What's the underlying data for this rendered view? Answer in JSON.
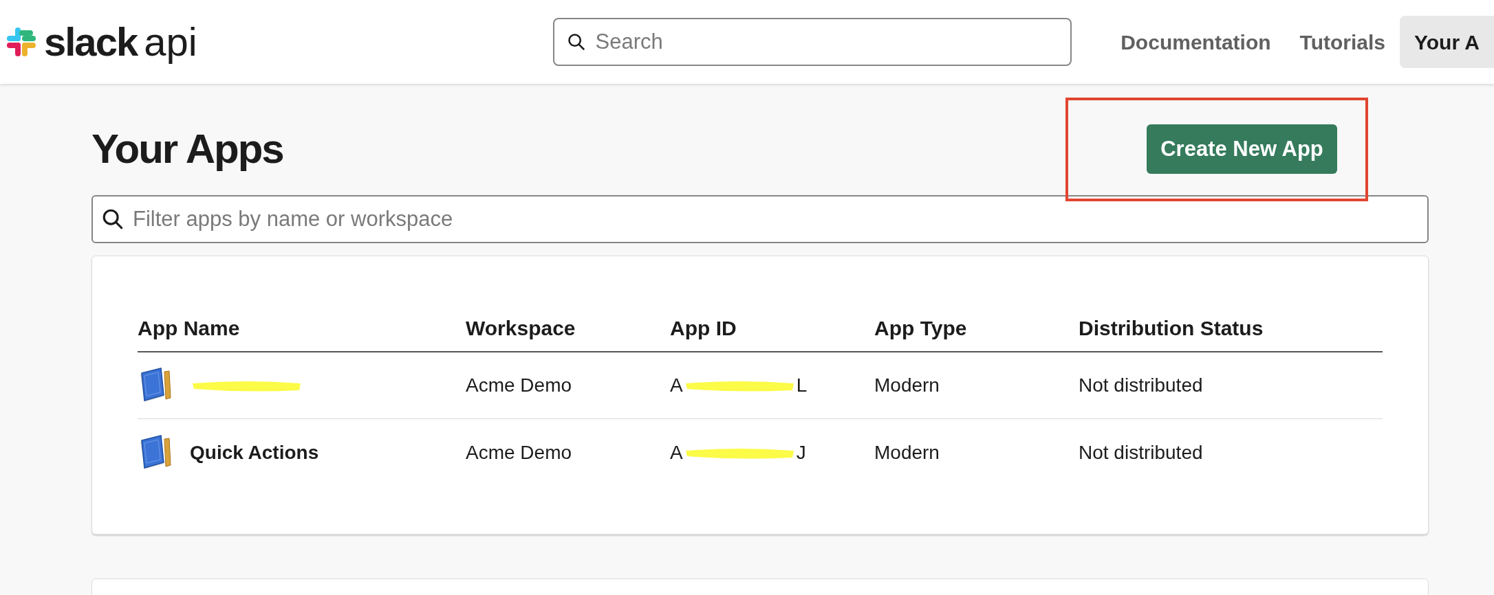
{
  "header": {
    "logo": {
      "brand": "slack",
      "product": "api"
    },
    "search": {
      "placeholder": "Search"
    },
    "nav": [
      {
        "label": "Documentation",
        "selected": false
      },
      {
        "label": "Tutorials",
        "selected": false
      },
      {
        "label": "Your A",
        "selected": true
      }
    ]
  },
  "page": {
    "title": "Your Apps",
    "create_button": "Create New App",
    "highlight_box": true,
    "filter": {
      "placeholder": "Filter apps by name or workspace"
    }
  },
  "table": {
    "columns": [
      "App Name",
      "Workspace",
      "App ID",
      "App Type",
      "Distribution Status"
    ],
    "rows": [
      {
        "name": "",
        "name_redacted": true,
        "workspace": "Acme Demo",
        "app_id_start": "A",
        "app_id_end": "L",
        "app_type": "Modern",
        "distribution": "Not distributed"
      },
      {
        "name": "Quick Actions",
        "name_redacted": false,
        "workspace": "Acme Demo",
        "app_id_start": "A",
        "app_id_end": "J",
        "app_type": "Modern",
        "distribution": "Not distributed"
      }
    ]
  }
}
